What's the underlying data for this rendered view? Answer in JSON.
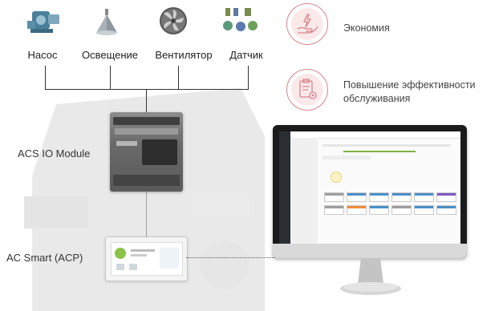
{
  "devices": [
    {
      "id": "pump",
      "icon": "pump-icon",
      "label": "Насос"
    },
    {
      "id": "lighting",
      "icon": "lamp-icon",
      "label": "Освещение"
    },
    {
      "id": "fan",
      "icon": "fan-icon",
      "label": "Вентилятор"
    },
    {
      "id": "sensor",
      "icon": "sensor-icon",
      "label": "Датчик"
    }
  ],
  "benefits": [
    {
      "icon": "hand-energy-icon",
      "text": "Экономия"
    },
    {
      "icon": "clipboard-gear-icon",
      "text": "Повышение эффективности обслуживания"
    }
  ],
  "components": {
    "io_module": "ACS IO Module",
    "ac_smart": "AC Smart (ACP)"
  },
  "colors": {
    "accent": "#d9848c",
    "line": "#333333"
  }
}
